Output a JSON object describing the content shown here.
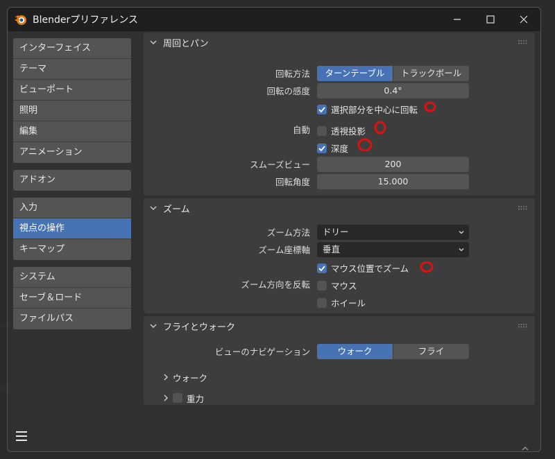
{
  "window": {
    "title": "Blenderプリファレンス"
  },
  "sidebar": {
    "groups": [
      {
        "items": [
          {
            "label": "インターフェイス",
            "active": false
          },
          {
            "label": "テーマ",
            "active": false
          },
          {
            "label": "ビューポート",
            "active": false
          },
          {
            "label": "照明",
            "active": false
          },
          {
            "label": "編集",
            "active": false
          },
          {
            "label": "アニメーション",
            "active": false
          }
        ]
      },
      {
        "items": [
          {
            "label": "アドオン",
            "active": false
          }
        ]
      },
      {
        "items": [
          {
            "label": "入力",
            "active": false
          },
          {
            "label": "視点の操作",
            "active": true
          },
          {
            "label": "キーマップ",
            "active": false
          }
        ]
      },
      {
        "items": [
          {
            "label": "システム",
            "active": false
          },
          {
            "label": "セーブ＆ロード",
            "active": false
          },
          {
            "label": "ファイルパス",
            "active": false
          }
        ]
      }
    ]
  },
  "orbit": {
    "title": "周回とパン",
    "method_label": "回転方法",
    "method_options": [
      "ターンテーブル",
      "トラックボール"
    ],
    "method_selected": "ターンテーブル",
    "sensitivity_label": "回転の感度",
    "sensitivity_value": "0.4°",
    "orbit_selection_label": "選択部分を中心に回転",
    "orbit_selection_checked": true,
    "auto_label": "自動",
    "auto_perspective_label": "透視投影",
    "auto_perspective_checked": false,
    "auto_depth_label": "深度",
    "auto_depth_checked": true,
    "smooth_view_label": "スムーズビュー",
    "smooth_view_value": "200",
    "rotation_angle_label": "回転角度",
    "rotation_angle_value": "15.000"
  },
  "zoom": {
    "title": "ズーム",
    "method_label": "ズーム方法",
    "method_value": "ドリー",
    "axis_label": "ズーム座標軸",
    "axis_value": "垂直",
    "zoom_to_mouse_label": "マウス位置でズーム",
    "zoom_to_mouse_checked": true,
    "invert_label": "ズーム方向を反転",
    "invert_mouse_label": "マウス",
    "invert_mouse_checked": false,
    "invert_wheel_label": "ホイール",
    "invert_wheel_checked": false
  },
  "fly": {
    "title": "フライとウォーク",
    "nav_label": "ビューのナビゲーション",
    "nav_options": [
      "ウォーク",
      "フライ"
    ],
    "nav_selected": "ウォーク",
    "walk_label": "ウォーク",
    "gravity_label": "重力",
    "gravity_checked": false
  },
  "colors": {
    "accent": "#4772b3",
    "annotation": "#e01010"
  },
  "icons": {
    "app": "blender-logo-icon",
    "minimize": "minimize-icon",
    "maximize": "maximize-icon",
    "close": "close-icon",
    "menu": "hamburger-menu-icon"
  }
}
